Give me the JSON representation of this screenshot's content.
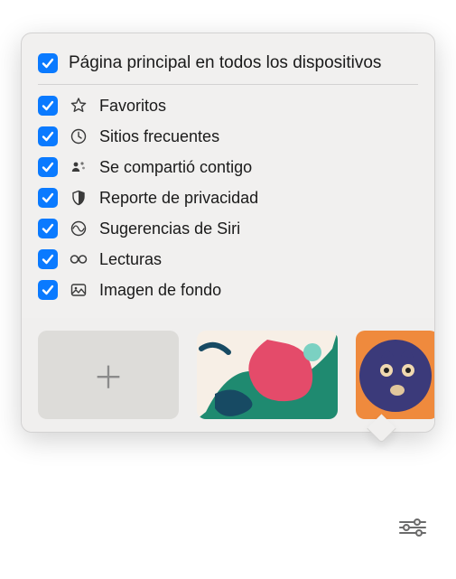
{
  "header": {
    "label": "Página principal en todos los dispositivos"
  },
  "options": {
    "favorites": {
      "label": "Favoritos"
    },
    "frequent": {
      "label": "Sitios frecuentes"
    },
    "shared": {
      "label": "Se compartió contigo"
    },
    "privacy": {
      "label": "Reporte de privacidad"
    },
    "siri": {
      "label": "Sugerencias de Siri"
    },
    "reading": {
      "label": "Lecturas"
    },
    "background": {
      "label": "Imagen de fondo"
    }
  },
  "thumbnails": {
    "add": {
      "icon": "plus"
    }
  }
}
